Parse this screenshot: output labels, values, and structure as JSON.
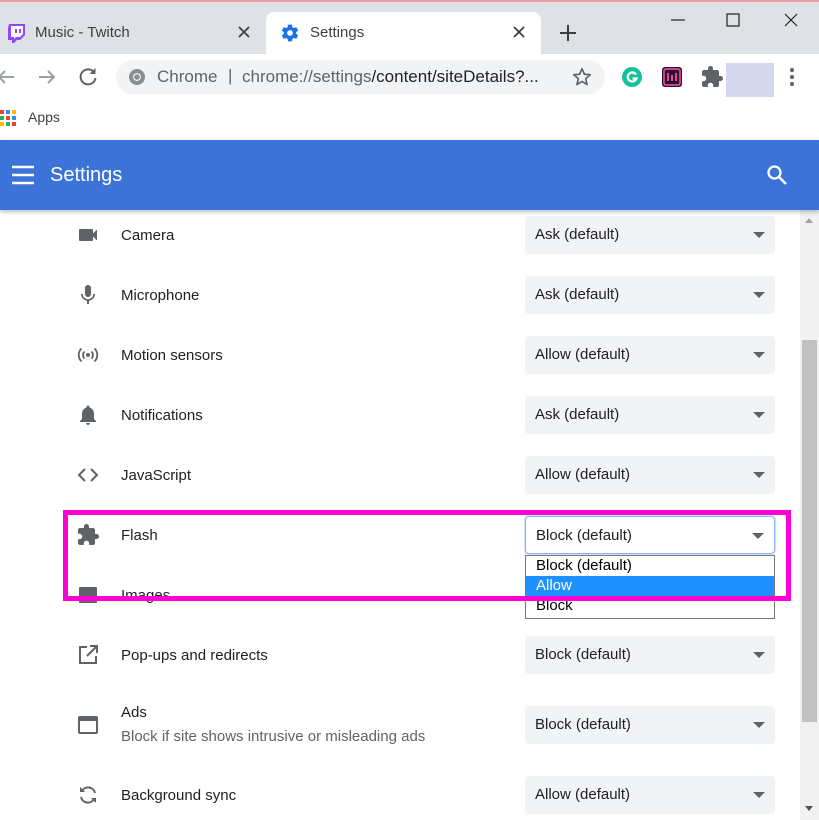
{
  "tabs": [
    {
      "title": "Music - Twitch",
      "active": false
    },
    {
      "title": "Settings",
      "active": true
    }
  ],
  "omnibox": {
    "brand": "Chrome",
    "separator": "|",
    "url_host": "chrome://settings",
    "url_path": "/content/siteDetails?..."
  },
  "bookmarks": {
    "apps_label": "Apps"
  },
  "header": {
    "title": "Settings"
  },
  "permissions": [
    {
      "label": "Camera",
      "value": "Ask (default)",
      "icon": "camera-icon"
    },
    {
      "label": "Microphone",
      "value": "Ask (default)",
      "icon": "microphone-icon"
    },
    {
      "label": "Motion sensors",
      "value": "Allow (default)",
      "icon": "motion-sensors-icon"
    },
    {
      "label": "Notifications",
      "value": "Ask (default)",
      "icon": "bell-icon"
    },
    {
      "label": "JavaScript",
      "value": "Allow (default)",
      "icon": "code-icon"
    },
    {
      "label": "Flash",
      "value": "Block (default)",
      "icon": "puzzle-icon"
    },
    {
      "label": "Images",
      "value": "",
      "icon": "image-icon"
    },
    {
      "label": "Pop-ups and redirects",
      "value": "Block (default)",
      "icon": "open-in-new-icon"
    },
    {
      "label": "Ads",
      "sublabel": "Block if site shows intrusive or misleading ads",
      "value": "Block (default)",
      "icon": "window-icon"
    },
    {
      "label": "Background sync",
      "value": "Allow (default)",
      "icon": "sync-icon"
    }
  ],
  "flash_dropdown": {
    "options": [
      "Block (default)",
      "Allow",
      "Block"
    ],
    "highlighted": "Allow"
  },
  "colors": {
    "header": "#3c73d9",
    "highlight_box": "#ff00d4",
    "option_selected": "#1e90ff"
  }
}
